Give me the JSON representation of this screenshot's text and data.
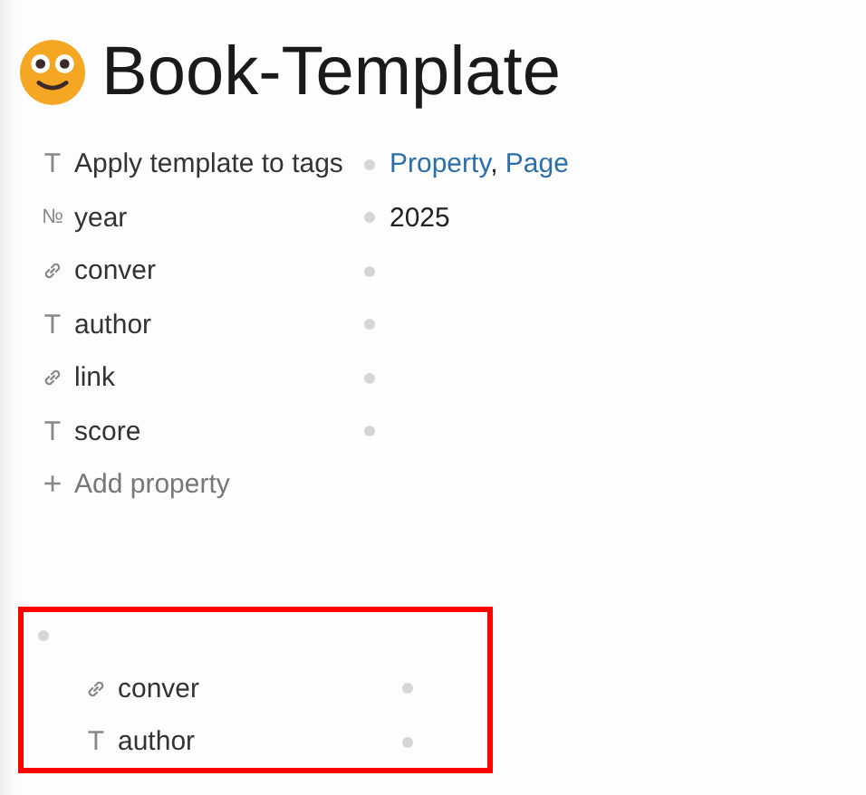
{
  "page": {
    "title": "Book-Template"
  },
  "properties": [
    {
      "kind": "text",
      "glyph": "T",
      "label": "Apply template to tags",
      "value": [
        {
          "kind": "link",
          "text": "Property"
        },
        {
          "kind": "plain",
          "text": ", "
        },
        {
          "kind": "link",
          "text": "Page"
        }
      ]
    },
    {
      "kind": "number",
      "glyph": "№",
      "label": "year",
      "value": [
        {
          "kind": "plain",
          "text": "2025"
        }
      ]
    },
    {
      "kind": "link",
      "label": "conver"
    },
    {
      "kind": "text",
      "glyph": "T",
      "label": "author"
    },
    {
      "kind": "link",
      "label": "link"
    },
    {
      "kind": "text",
      "glyph": "T",
      "label": "score"
    }
  ],
  "add_property": {
    "glyph": "+",
    "label": "Add property"
  },
  "highlighted_block": {
    "properties": [
      {
        "kind": "link",
        "label": "conver"
      },
      {
        "kind": "text",
        "glyph": "T",
        "label": "author"
      }
    ]
  }
}
